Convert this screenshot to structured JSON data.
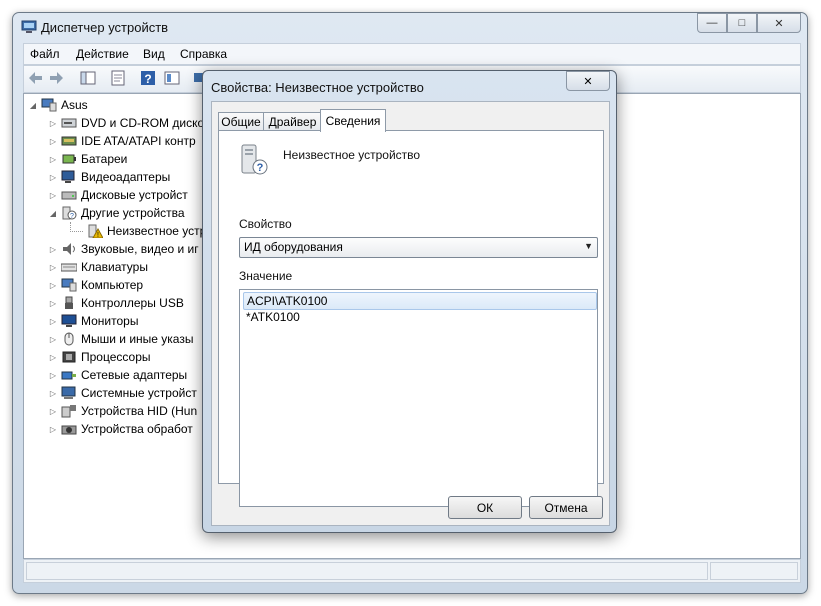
{
  "window": {
    "title": "Диспетчер устройств"
  },
  "menu": [
    "Файл",
    "Действие",
    "Вид",
    "Справка"
  ],
  "tree": {
    "root": "Asus",
    "items": [
      {
        "label": "DVD и CD-ROM диско",
        "icon": "dvd-drive-icon",
        "expanded": false
      },
      {
        "label": "IDE ATA/ATAPI контр",
        "icon": "ide-controller-icon",
        "expanded": false
      },
      {
        "label": "Батареи",
        "icon": "battery-icon",
        "expanded": false
      },
      {
        "label": "Видеоадаптеры",
        "icon": "display-adapter-icon",
        "expanded": false
      },
      {
        "label": "Дисковые устройст",
        "icon": "disk-drive-icon",
        "expanded": false
      },
      {
        "label": "Другие устройства",
        "icon": "unknown-device-icon",
        "expanded": true
      },
      {
        "label": "Неизвестное устр",
        "icon": "warning-device-icon",
        "child": true
      },
      {
        "label": "Звуковые, видео и иг",
        "icon": "sound-icon",
        "expanded": false
      },
      {
        "label": "Клавиатуры",
        "icon": "keyboard-icon",
        "expanded": false
      },
      {
        "label": "Компьютер",
        "icon": "computer-icon",
        "expanded": false
      },
      {
        "label": "Контроллеры USB",
        "icon": "usb-icon",
        "expanded": false
      },
      {
        "label": "Мониторы",
        "icon": "monitor-icon",
        "expanded": false
      },
      {
        "label": "Мыши и иные указы",
        "icon": "mouse-icon",
        "expanded": false
      },
      {
        "label": "Процессоры",
        "icon": "processor-icon",
        "expanded": false
      },
      {
        "label": "Сетевые адаптеры",
        "icon": "network-adapter-icon",
        "expanded": false
      },
      {
        "label": "Системные устройст",
        "icon": "system-device-icon",
        "expanded": false
      },
      {
        "label": "Устройства HID (Hun",
        "icon": "hid-icon",
        "expanded": false
      },
      {
        "label": "Устройства обработ",
        "icon": "imaging-device-icon",
        "expanded": false
      }
    ]
  },
  "dialog": {
    "title": "Свойства: Неизвестное устройство",
    "tabs": [
      "Общие",
      "Драйвер",
      "Сведения"
    ],
    "active_tab": "Сведения",
    "device_name": "Неизвестное устройство",
    "property_label": "Свойство",
    "property_value": "ИД оборудования",
    "value_label": "Значение",
    "values": [
      "ACPI\\ATK0100",
      "*ATK0100"
    ],
    "ok_label": "ОК",
    "cancel_label": "Отмена"
  },
  "colors": {
    "accent": "#3a78c4",
    "warning": "#e8b800",
    "window": "#dfe8f2"
  }
}
